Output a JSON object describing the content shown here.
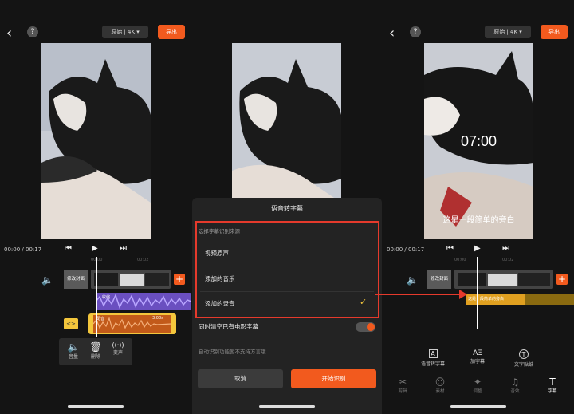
{
  "top": {
    "back_icon": "‹",
    "help_icon": "?",
    "resolution_label": "原始 | 4K ▾",
    "export_label": "导出"
  },
  "playback": {
    "time_current": "00:00",
    "time_total": "/ 00:17",
    "prev_icon": "⏮",
    "play_icon": "▶",
    "next_icon": "⏭",
    "ticks": [
      "00:00",
      "00:02"
    ]
  },
  "left_panel": {
    "cover_label": "修改封面",
    "audio_track_label": "收缩",
    "record_track_label": "配音",
    "record_duration": "3.00s",
    "edit_tools": [
      {
        "icon": "🔈",
        "label": "音量"
      },
      {
        "icon": "🗑",
        "label": "删除"
      },
      {
        "icon": "((·))",
        "label": "变声"
      }
    ]
  },
  "dialog": {
    "title": "语音转字幕",
    "source_heading": "选择字幕识别来源",
    "options": [
      "视频原声",
      "添加的音乐",
      "添加的录音"
    ],
    "selected_index": 2,
    "clear_label": "同时清空已有电影字幕",
    "note": "自动识别功能暂不支持方言哦",
    "cancel_label": "取消",
    "start_label": "开始识别"
  },
  "right_panel": {
    "overlay_time": "07:00",
    "overlay_caption": "这是一段简单的旁白",
    "subtitle_clip_label": "这是一段简单的旁白",
    "tools": [
      {
        "icon": "A",
        "label": "语音转字幕"
      },
      {
        "icon": "AΞ",
        "label": "加字幕"
      },
      {
        "icon": "T",
        "label": "文字贴纸"
      }
    ],
    "tabs": [
      {
        "icon": "✂",
        "label": "剪辑"
      },
      {
        "icon": "☺",
        "label": "素材"
      },
      {
        "icon": "✦",
        "label": "调整"
      },
      {
        "icon": "♫",
        "label": "音效"
      },
      {
        "icon": "T",
        "label": "字幕"
      }
    ]
  },
  "colors": {
    "accent": "#f25a1e",
    "highlight_box": "#e53a2c",
    "check": "#f3c63c",
    "subtitle_track": "#e0a020"
  }
}
